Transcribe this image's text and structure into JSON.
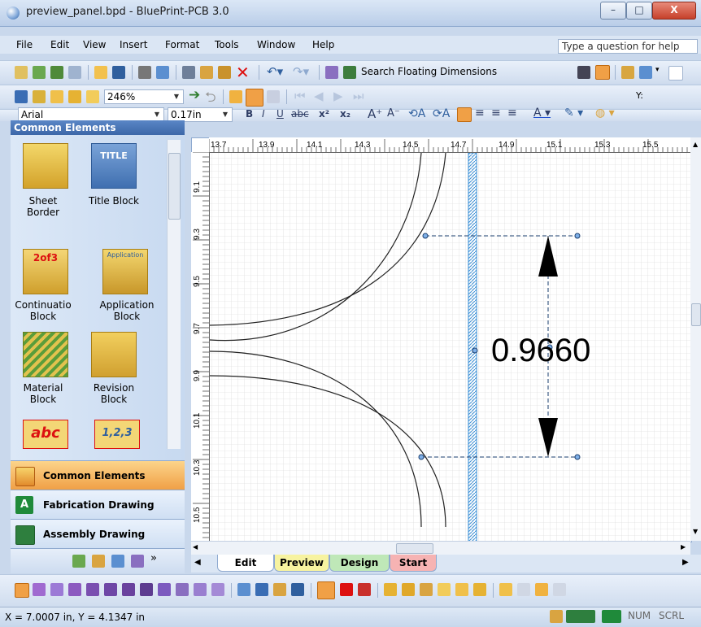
{
  "window": {
    "title": "preview_panel.bpd - BluePrint-PCB 3.0",
    "minimize_label": "–",
    "maximize_label": "□",
    "close_label": "X"
  },
  "menu": {
    "items": [
      "File",
      "Edit",
      "View",
      "Insert",
      "Format",
      "Tools",
      "Window",
      "Help"
    ],
    "help_placeholder": "Type a question for help"
  },
  "toolbar1": {
    "search_label": "Search Floating Dimensions"
  },
  "toolbar2": {
    "zoom": "246%",
    "y_label": "Y:"
  },
  "toolbar3": {
    "font": "Arial",
    "size": "0.17in",
    "bold": "B",
    "italic": "I",
    "underline": "U",
    "strike": "abc",
    "superscript": "x²",
    "subscript": "x₂"
  },
  "panel": {
    "header": "Common Elements",
    "elements": [
      {
        "label": "Sheet\nBorder",
        "icon": "sheet-border-icon"
      },
      {
        "label": "Title Block",
        "icon": "title-block-icon"
      },
      {
        "label": "Continuatio\nBlock",
        "icon": "continuation-block-icon"
      },
      {
        "label": "Application\nBlock",
        "icon": "application-block-icon"
      },
      {
        "label": "Material\nBlock",
        "icon": "material-block-icon"
      },
      {
        "label": "Revision\nBlock",
        "icon": "revision-block-icon"
      },
      {
        "label": "",
        "icon": "text-abc-icon"
      },
      {
        "label": "",
        "icon": "numbering-icon"
      }
    ],
    "icon_texts": {
      "title": "TITLE",
      "cont": "2of3",
      "app": "Application",
      "abc": "abc",
      "num": "1,2,3"
    },
    "nav": [
      {
        "label": "Common Elements",
        "icon": "common-elements-icon"
      },
      {
        "label": "Fabrication Drawing",
        "icon": "fabrication-icon"
      },
      {
        "label": "Assembly Drawing",
        "icon": "assembly-icon"
      }
    ]
  },
  "rulers": {
    "h_ticks": [
      "13.7",
      "13.9",
      "14.1",
      "14.3",
      "14.5",
      "14.7",
      "14.9",
      "15.1",
      "15.3",
      "15.5"
    ],
    "v_ticks": [
      "9.1",
      "9.3",
      "9.5",
      "9.7",
      "9.9",
      "10.1",
      "10.3",
      "10.5"
    ]
  },
  "canvas": {
    "dimension_value": "0.9660"
  },
  "tabs": [
    {
      "label": "Edit",
      "color": "#ffffff"
    },
    {
      "label": "Preview",
      "color": "#f7f3a0"
    },
    {
      "label": "Design",
      "color": "#bfe8b8"
    },
    {
      "label": "Start",
      "color": "#f6b3b3"
    }
  ],
  "status": {
    "coords": "X = 7.0007 in, Y = 4.1347 in",
    "num": "NUM",
    "scrl": "SCRL"
  },
  "colors": {
    "accent_orange": "#f0a046",
    "panel_header": "#3c67a8",
    "hatch_blue": "#3a8fd6"
  }
}
